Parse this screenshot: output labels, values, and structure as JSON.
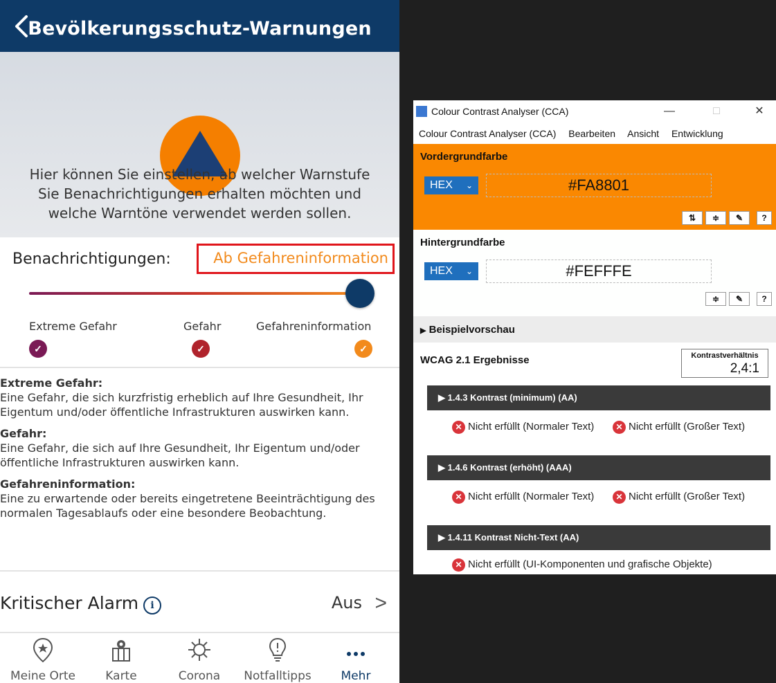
{
  "app": {
    "title": "Bevölkerungsschutz-Warnungen",
    "intro_text": "Hier können Sie einstellen, ab welcher Warnstufe Sie Benachrichtigungen erhalten möchten und welche Warntöne verwendet werden sollen.",
    "notifications_label": "Benachrichtigungen:",
    "notifications_value": "Ab Gefahreninformation",
    "slider_position": 1.0,
    "levels": [
      {
        "label": "Extreme Gefahr",
        "color": "#7a1a55"
      },
      {
        "label": "Gefahr",
        "color": "#b0232c"
      },
      {
        "label": "Gefahreninformation",
        "color": "#f28a1c"
      }
    ],
    "descriptions": [
      {
        "term": "Extreme Gefahr:",
        "text": "Eine Gefahr, die sich kurzfristig erheblich auf Ihre Gesundheit, Ihr Eigentum und/oder öffentliche Infrastrukturen auswirken kann."
      },
      {
        "term": "Gefahr:",
        "text": "Eine Gefahr, die sich auf Ihre Gesundheit, Ihr Eigentum und/oder öffentliche Infrastrukturen auswirken kann."
      },
      {
        "term": "Gefahreninformation:",
        "text": "Eine zu erwartende oder bereits eingetretene Beeinträchtigung des normalen Tagesablaufs oder eine besondere Beobachtung."
      }
    ],
    "critical_alarm": {
      "label": "Kritischer Alarm",
      "value": "Aus"
    },
    "tabs": [
      {
        "label": "Meine Orte",
        "icon": "location-star-icon"
      },
      {
        "label": "Karte",
        "icon": "map-icon"
      },
      {
        "label": "Corona",
        "icon": "virus-icon"
      },
      {
        "label": "Notfalltipps",
        "icon": "lightbulb-icon"
      },
      {
        "label": "Mehr",
        "icon": "more-dots-icon",
        "active": true
      }
    ],
    "colors": {
      "header": "#0e3a67",
      "accent": "#f28a1c",
      "logo_orange": "#f57f00",
      "logo_triangle": "#1c3f75"
    }
  },
  "cca": {
    "window_title": "Colour Contrast Analyser (CCA)",
    "menu": [
      "Colour Contrast Analyser (CCA)",
      "Bearbeiten",
      "Ansicht",
      "Entwicklung"
    ],
    "foreground": {
      "title": "Vordergrundfarbe",
      "format": "HEX",
      "value": "#FA8801"
    },
    "background": {
      "title": "Hintergrundfarbe",
      "format": "HEX",
      "value": "#FEFFFE"
    },
    "preview_label": "Beispielvorschau",
    "wcag_title": "WCAG 2.1 Ergebnisse",
    "ratio_label": "Kontrastverhältnis",
    "ratio_value": "2,4:1",
    "criteria": [
      {
        "title": "1.4.3 Kontrast (minimum) (AA)",
        "results": [
          "Nicht erfüllt (Normaler Text)",
          "Nicht erfüllt (Großer Text)"
        ]
      },
      {
        "title": "1.4.6 Kontrast (erhöht) (AAA)",
        "results": [
          "Nicht erfüllt (Normaler Text)",
          "Nicht erfüllt (Großer Text)"
        ]
      },
      {
        "title": "1.4.11 Kontrast Nicht-Text (AA)",
        "results": [
          "Nicht erfüllt (UI-Komponenten und grafische Objekte)"
        ]
      }
    ]
  }
}
